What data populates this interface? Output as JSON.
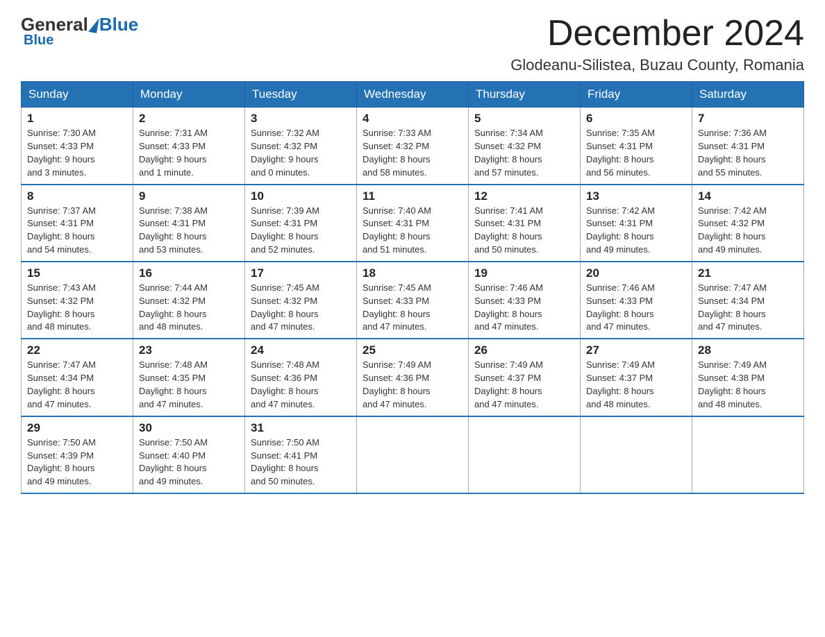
{
  "logo": {
    "general": "General",
    "blue": "Blue"
  },
  "header": {
    "title": "December 2024",
    "location": "Glodeanu-Silistea, Buzau County, Romania"
  },
  "weekdays": [
    "Sunday",
    "Monday",
    "Tuesday",
    "Wednesday",
    "Thursday",
    "Friday",
    "Saturday"
  ],
  "weeks": [
    [
      {
        "day": "1",
        "sunrise": "7:30 AM",
        "sunset": "4:33 PM",
        "daylight": "9 hours and 3 minutes."
      },
      {
        "day": "2",
        "sunrise": "7:31 AM",
        "sunset": "4:33 PM",
        "daylight": "9 hours and 1 minute."
      },
      {
        "day": "3",
        "sunrise": "7:32 AM",
        "sunset": "4:32 PM",
        "daylight": "9 hours and 0 minutes."
      },
      {
        "day": "4",
        "sunrise": "7:33 AM",
        "sunset": "4:32 PM",
        "daylight": "8 hours and 58 minutes."
      },
      {
        "day": "5",
        "sunrise": "7:34 AM",
        "sunset": "4:32 PM",
        "daylight": "8 hours and 57 minutes."
      },
      {
        "day": "6",
        "sunrise": "7:35 AM",
        "sunset": "4:31 PM",
        "daylight": "8 hours and 56 minutes."
      },
      {
        "day": "7",
        "sunrise": "7:36 AM",
        "sunset": "4:31 PM",
        "daylight": "8 hours and 55 minutes."
      }
    ],
    [
      {
        "day": "8",
        "sunrise": "7:37 AM",
        "sunset": "4:31 PM",
        "daylight": "8 hours and 54 minutes."
      },
      {
        "day": "9",
        "sunrise": "7:38 AM",
        "sunset": "4:31 PM",
        "daylight": "8 hours and 53 minutes."
      },
      {
        "day": "10",
        "sunrise": "7:39 AM",
        "sunset": "4:31 PM",
        "daylight": "8 hours and 52 minutes."
      },
      {
        "day": "11",
        "sunrise": "7:40 AM",
        "sunset": "4:31 PM",
        "daylight": "8 hours and 51 minutes."
      },
      {
        "day": "12",
        "sunrise": "7:41 AM",
        "sunset": "4:31 PM",
        "daylight": "8 hours and 50 minutes."
      },
      {
        "day": "13",
        "sunrise": "7:42 AM",
        "sunset": "4:31 PM",
        "daylight": "8 hours and 49 minutes."
      },
      {
        "day": "14",
        "sunrise": "7:42 AM",
        "sunset": "4:32 PM",
        "daylight": "8 hours and 49 minutes."
      }
    ],
    [
      {
        "day": "15",
        "sunrise": "7:43 AM",
        "sunset": "4:32 PM",
        "daylight": "8 hours and 48 minutes."
      },
      {
        "day": "16",
        "sunrise": "7:44 AM",
        "sunset": "4:32 PM",
        "daylight": "8 hours and 48 minutes."
      },
      {
        "day": "17",
        "sunrise": "7:45 AM",
        "sunset": "4:32 PM",
        "daylight": "8 hours and 47 minutes."
      },
      {
        "day": "18",
        "sunrise": "7:45 AM",
        "sunset": "4:33 PM",
        "daylight": "8 hours and 47 minutes."
      },
      {
        "day": "19",
        "sunrise": "7:46 AM",
        "sunset": "4:33 PM",
        "daylight": "8 hours and 47 minutes."
      },
      {
        "day": "20",
        "sunrise": "7:46 AM",
        "sunset": "4:33 PM",
        "daylight": "8 hours and 47 minutes."
      },
      {
        "day": "21",
        "sunrise": "7:47 AM",
        "sunset": "4:34 PM",
        "daylight": "8 hours and 47 minutes."
      }
    ],
    [
      {
        "day": "22",
        "sunrise": "7:47 AM",
        "sunset": "4:34 PM",
        "daylight": "8 hours and 47 minutes."
      },
      {
        "day": "23",
        "sunrise": "7:48 AM",
        "sunset": "4:35 PM",
        "daylight": "8 hours and 47 minutes."
      },
      {
        "day": "24",
        "sunrise": "7:48 AM",
        "sunset": "4:36 PM",
        "daylight": "8 hours and 47 minutes."
      },
      {
        "day": "25",
        "sunrise": "7:49 AM",
        "sunset": "4:36 PM",
        "daylight": "8 hours and 47 minutes."
      },
      {
        "day": "26",
        "sunrise": "7:49 AM",
        "sunset": "4:37 PM",
        "daylight": "8 hours and 47 minutes."
      },
      {
        "day": "27",
        "sunrise": "7:49 AM",
        "sunset": "4:37 PM",
        "daylight": "8 hours and 48 minutes."
      },
      {
        "day": "28",
        "sunrise": "7:49 AM",
        "sunset": "4:38 PM",
        "daylight": "8 hours and 48 minutes."
      }
    ],
    [
      {
        "day": "29",
        "sunrise": "7:50 AM",
        "sunset": "4:39 PM",
        "daylight": "8 hours and 49 minutes."
      },
      {
        "day": "30",
        "sunrise": "7:50 AM",
        "sunset": "4:40 PM",
        "daylight": "8 hours and 49 minutes."
      },
      {
        "day": "31",
        "sunrise": "7:50 AM",
        "sunset": "4:41 PM",
        "daylight": "8 hours and 50 minutes."
      },
      null,
      null,
      null,
      null
    ]
  ],
  "labels": {
    "sunrise": "Sunrise:",
    "sunset": "Sunset:",
    "daylight": "Daylight:"
  }
}
